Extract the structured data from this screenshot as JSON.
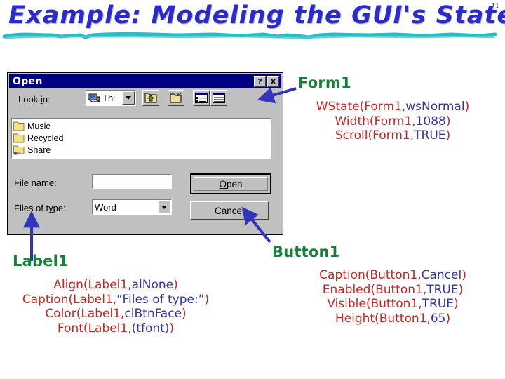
{
  "slide": {
    "number": "11",
    "title": "Example: Modeling the GUI's State",
    "title_color": "#2b2bcc",
    "underline_color": "#2eb8c8"
  },
  "dialog": {
    "title": "Open",
    "help_button": "?",
    "close_button": "X",
    "lookin_label_pre": "Look ",
    "lookin_label_underlined": "i",
    "lookin_label_post": "n:",
    "lookin_value": "Thi",
    "toolbar": [
      {
        "name": "up-one-level-icon",
        "tooltip": "Up One Level"
      },
      {
        "name": "create-new-folder-icon",
        "tooltip": "Create New Folder"
      },
      {
        "name": "list-view-icon",
        "tooltip": "List"
      },
      {
        "name": "details-view-icon",
        "tooltip": "Details"
      }
    ],
    "files": [
      {
        "label": "Music",
        "icon": "folder-icon"
      },
      {
        "label": "Recycled",
        "icon": "folder-icon"
      },
      {
        "label": "Share",
        "icon": "shared-folder-icon"
      }
    ],
    "filename_label_pre": "File ",
    "filename_label_underlined": "n",
    "filename_label_post": "ame:",
    "filename_value": "",
    "filetype_label_pre": "Files of t",
    "filetype_label_underlined": "y",
    "filetype_label_post": "pe:",
    "filetype_value": "Word",
    "open_button_pre": "",
    "open_button_underlined": "O",
    "open_button_post": "pen",
    "cancel_button": "Cancel"
  },
  "annotations": {
    "colors": {
      "object_name": "#188038",
      "predicate": "#cc2222",
      "argument": "#3333aa",
      "arrow": "#3333bb"
    },
    "form1": {
      "name": "Form1",
      "facts": [
        {
          "pred": "WState(Form1,",
          "arg": "wsNormal",
          "close": ")"
        },
        {
          "pred": "Width(Form1,",
          "arg": "1088",
          "close": ")"
        },
        {
          "pred": "Scroll(Form1,",
          "arg": "TRUE",
          "close": ")"
        }
      ]
    },
    "button1": {
      "name": "Button1",
      "facts": [
        {
          "pred": "Caption(Button1,",
          "arg": "Cancel",
          "close": ")"
        },
        {
          "pred": "Enabled(Button1,",
          "arg": "TRUE",
          "close": ")"
        },
        {
          "pred": "Visible(Button1,",
          "arg": "TRUE",
          "close": ")"
        },
        {
          "pred": "Height(Button1,",
          "arg": "65",
          "close": ")"
        }
      ]
    },
    "label1": {
      "name": "Label1",
      "facts": [
        {
          "pred": "Align(Label1,",
          "arg": "alNone",
          "close": ")"
        },
        {
          "pred": "Caption(Label1,",
          "arg": "“Files of type:”",
          "close": ")"
        },
        {
          "pred": "Color(Label1,",
          "arg": "clBtnFace",
          "close": ")"
        },
        {
          "pred": "Font(Label1,",
          "arg": "(tfont)",
          "close": ")"
        }
      ]
    }
  }
}
